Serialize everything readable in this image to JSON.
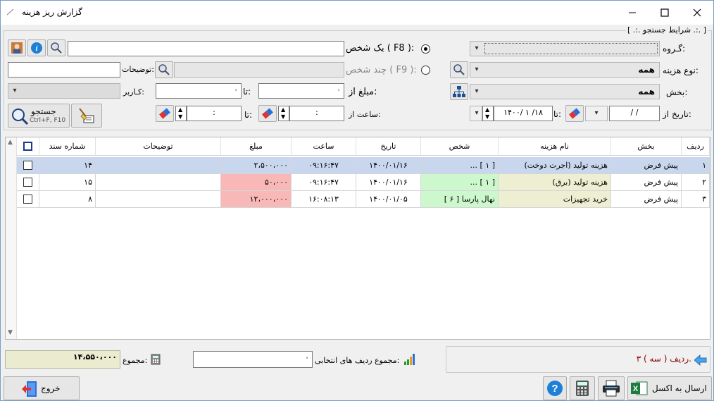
{
  "window": {
    "title": "گزارش ریز هزینه"
  },
  "filters": {
    "section_label": "[ .:. شرایط جستجو .:. ]",
    "group_label": "گـروه:",
    "cost_type_label": "نوع هزینه:",
    "cost_type_value": "همه",
    "section_field_label": "بخش:",
    "section_value": "همه",
    "date_from_label": "تاریخ از:",
    "date_from_value": "/    /",
    "date_to_label": "تا:",
    "date_to_value": "۱۴۰۰/ ۱ /۱۸",
    "single_person_label": "یک شخص ( F8 ):",
    "multi_person_label": "چند شخص ( F9 ):",
    "description_label": "توضیحات:",
    "amount_from_label": "مبلغ از:",
    "amount_from_value": "۰",
    "amount_to_label": "تا:",
    "amount_to_value": "۰",
    "user_label": "کـاربر:",
    "time_from_label": "ساعت از:",
    "time_from_value": ":",
    "time_to_label": "تا:",
    "time_to_value": ":",
    "search_button": "جستجو",
    "search_shortcut": "Ctrl+F, F10"
  },
  "table": {
    "columns": [
      "ردیف",
      "بخش",
      "نام هزینه",
      "شخص",
      "تاریخ",
      "ساعت",
      "مبلغ",
      "توضیحات",
      "شماره سند"
    ],
    "rows": [
      {
        "row": "۱",
        "section": "پیش فرض",
        "cost_name": "هزینه تولید (اجرت دوخت)",
        "person": "... [ ۱ ]",
        "date": "۱۴۰۰/۰۱/۱۶",
        "time": "۰۹:۱۶:۴۷",
        "amount": "۲،۵۰۰،۰۰۰",
        "desc": "",
        "doc_no": "۱۴"
      },
      {
        "row": "۲",
        "section": "پیش فرض",
        "cost_name": "هزینه تولید (برق)",
        "person": "... [ ۱ ]",
        "date": "۱۴۰۰/۰۱/۱۶",
        "time": "۰۹:۱۶:۴۷",
        "amount": "۵۰،۰۰۰",
        "desc": "",
        "doc_no": "۱۵"
      },
      {
        "row": "۳",
        "section": "پیش فرض",
        "cost_name": "خرید تجهیزات",
        "person": "نهال پارسا  [ ۶ ]",
        "date": "۱۴۰۰/۰۱/۰۵",
        "time": "۱۶:۰۸:۱۳",
        "amount": "۱۲،۰۰۰،۰۰۰",
        "desc": "",
        "doc_no": "۸"
      }
    ]
  },
  "footer": {
    "row_count_text": "۳ ( سه ) ردیف.",
    "selected_sum_label": "مجموع ردیف های انتخابی:",
    "selected_sum_value": "۰",
    "total_label": "مجموع:",
    "total_value": "۱۴،۵۵۰،۰۰۰",
    "export_excel": "ارسال به اکسل",
    "exit": "خروج"
  },
  "colors": {
    "selected_row": "#c9d7ee",
    "amount_red": "#f9b8b8",
    "person_green": "#cdf7cd",
    "cost_beige": "#eeeed2",
    "total_bg": "#ebebd0"
  }
}
